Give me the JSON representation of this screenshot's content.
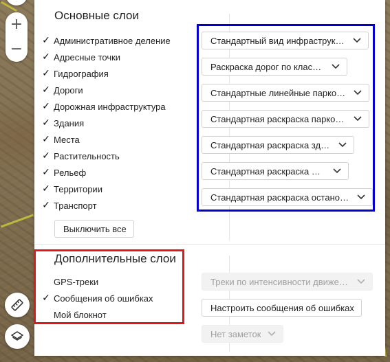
{
  "map_controls": {
    "zoom_in": "+",
    "zoom_out": "−"
  },
  "main_layers": {
    "title": "Основные слои",
    "items": [
      {
        "label": "Административное деление",
        "checked": true
      },
      {
        "label": "Адресные точки",
        "checked": true
      },
      {
        "label": "Гидрография",
        "checked": true
      },
      {
        "label": "Дороги",
        "checked": true
      },
      {
        "label": "Дорожная инфраструктура",
        "checked": true
      },
      {
        "label": "Здания",
        "checked": true
      },
      {
        "label": "Места",
        "checked": true
      },
      {
        "label": "Растительность",
        "checked": true
      },
      {
        "label": "Рельеф",
        "checked": true
      },
      {
        "label": "Территории",
        "checked": true
      },
      {
        "label": "Транспорт",
        "checked": true
      }
    ],
    "disable_all_label": "Выключить все",
    "styles": [
      "Стандартный вид инфраструктуры",
      "Раскраска дорог по классам",
      "Стандартные линейные парковки",
      "Стандартная раскраска парковок",
      "Стандартная раскраска зданий",
      "Стандартная раскраска мест",
      "Стандартная раскраска остановок"
    ]
  },
  "extra_layers": {
    "title": "Дополнительные слои",
    "items": [
      {
        "label": "GPS-треки",
        "checked": false
      },
      {
        "label": "Сообщения об ошибках",
        "checked": true
      },
      {
        "label": "Мой блокнот",
        "checked": false
      }
    ],
    "gps_select": "Треки по интенсивности движения",
    "gps_select_disabled": true,
    "errors_button": "Настроить сообщения об ошибках",
    "notes_select": "Нет заметок",
    "notes_select_disabled": true
  },
  "check_glyph": "✓",
  "colors": {
    "highlight_blue": "#0000c8",
    "highlight_red": "#e01818",
    "panel_bg": "#ffffff"
  },
  "icons": [
    "ruler-icon",
    "layers-icon",
    "chevron-down-icon",
    "check-icon"
  ]
}
